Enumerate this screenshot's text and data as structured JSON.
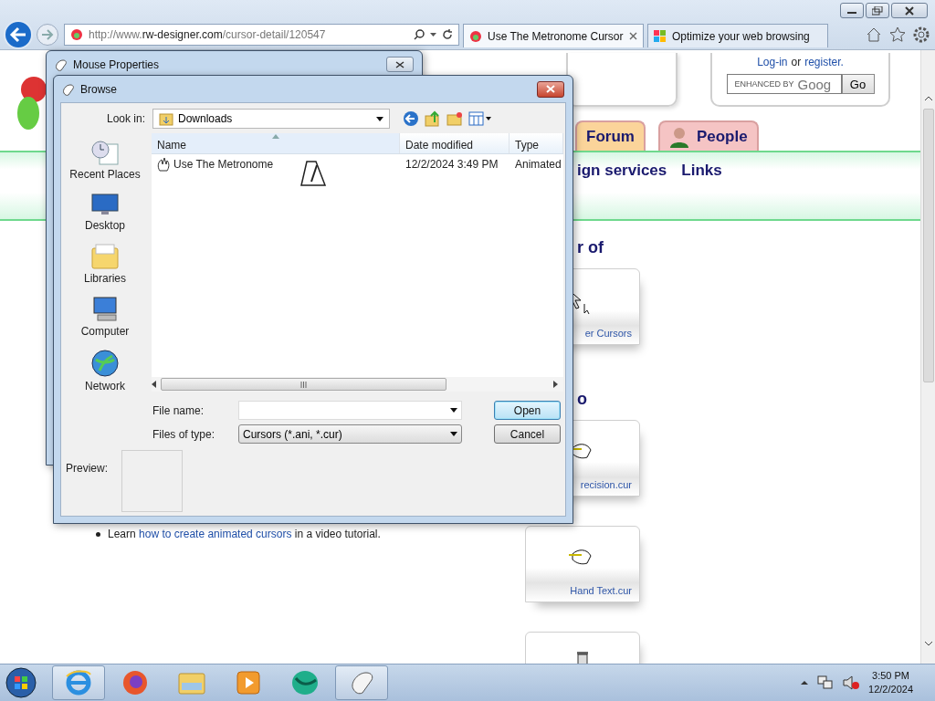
{
  "browser": {
    "address": {
      "scheme": "http://www.",
      "domain": "rw-designer.com",
      "path": "/cursor-detail/120547"
    },
    "tabs": [
      {
        "label": "Use The Metronome Cursor",
        "selected": true
      },
      {
        "label": "Optimize your web browsing",
        "selected": false
      }
    ]
  },
  "page": {
    "login": {
      "login": "Log-in",
      "or": "or",
      "register": "register."
    },
    "search": {
      "badge": "ENHANCED BY",
      "brand": "Goog",
      "button": "Go"
    },
    "nav_tabs": [
      {
        "label": "Forum",
        "color": "#fbd49a",
        "kind": "plain"
      },
      {
        "label": "People",
        "color": "#f5c4c4",
        "kind": "person"
      }
    ],
    "sub_nav": [
      {
        "label": "ign services"
      },
      {
        "label": "Links"
      }
    ],
    "bullet": {
      "before": "Learn",
      "link": "how to create animated cursors",
      "after": "in a video tutorial."
    },
    "sections": [
      {
        "heading": "r of",
        "cards": [
          {
            "kind": "help",
            "label": "er Cursors"
          }
        ]
      },
      {
        "heading": "o",
        "cards": [
          {
            "kind": "hand",
            "label": "recision.cur"
          },
          {
            "kind": "hand",
            "label": "Hand Text.cur"
          },
          {
            "kind": "hourglass"
          }
        ]
      }
    ]
  },
  "mouse_properties": {
    "title": "Mouse Properties"
  },
  "browse": {
    "title": "Browse",
    "look_in": {
      "label": "Look in:",
      "value": "Downloads"
    },
    "places": [
      {
        "label": "Recent Places",
        "kind": "recent"
      },
      {
        "label": "Desktop",
        "kind": "desktop"
      },
      {
        "label": "Libraries",
        "kind": "libraries"
      },
      {
        "label": "Computer",
        "kind": "computer"
      },
      {
        "label": "Network",
        "kind": "network"
      }
    ],
    "columns": [
      {
        "label": "Name",
        "sorted": true
      },
      {
        "label": "Date modified",
        "sorted": false
      },
      {
        "label": "Type",
        "sorted": false
      }
    ],
    "files": [
      {
        "name": "Use The Metronome",
        "date": "12/2/2024 3:49 PM",
        "type": "Animated"
      }
    ],
    "file_name": {
      "label": "File name:"
    },
    "file_type": {
      "label": "Files of type:",
      "value": "Cursors (*.ani, *.cur)"
    },
    "buttons": [
      {
        "label": "Open",
        "default": true
      },
      {
        "label": "Cancel",
        "default": false
      }
    ],
    "preview": {
      "label": "Preview:"
    }
  },
  "taskbar": {
    "apps": [
      {
        "kind": "ie",
        "running": true
      },
      {
        "kind": "firefox",
        "running": false
      },
      {
        "kind": "explorer",
        "running": false
      },
      {
        "kind": "media",
        "running": false
      },
      {
        "kind": "globe",
        "running": false
      },
      {
        "kind": "mouse",
        "running": true
      }
    ],
    "clock": {
      "time": "3:50 PM",
      "date": "12/2/2024"
    }
  }
}
